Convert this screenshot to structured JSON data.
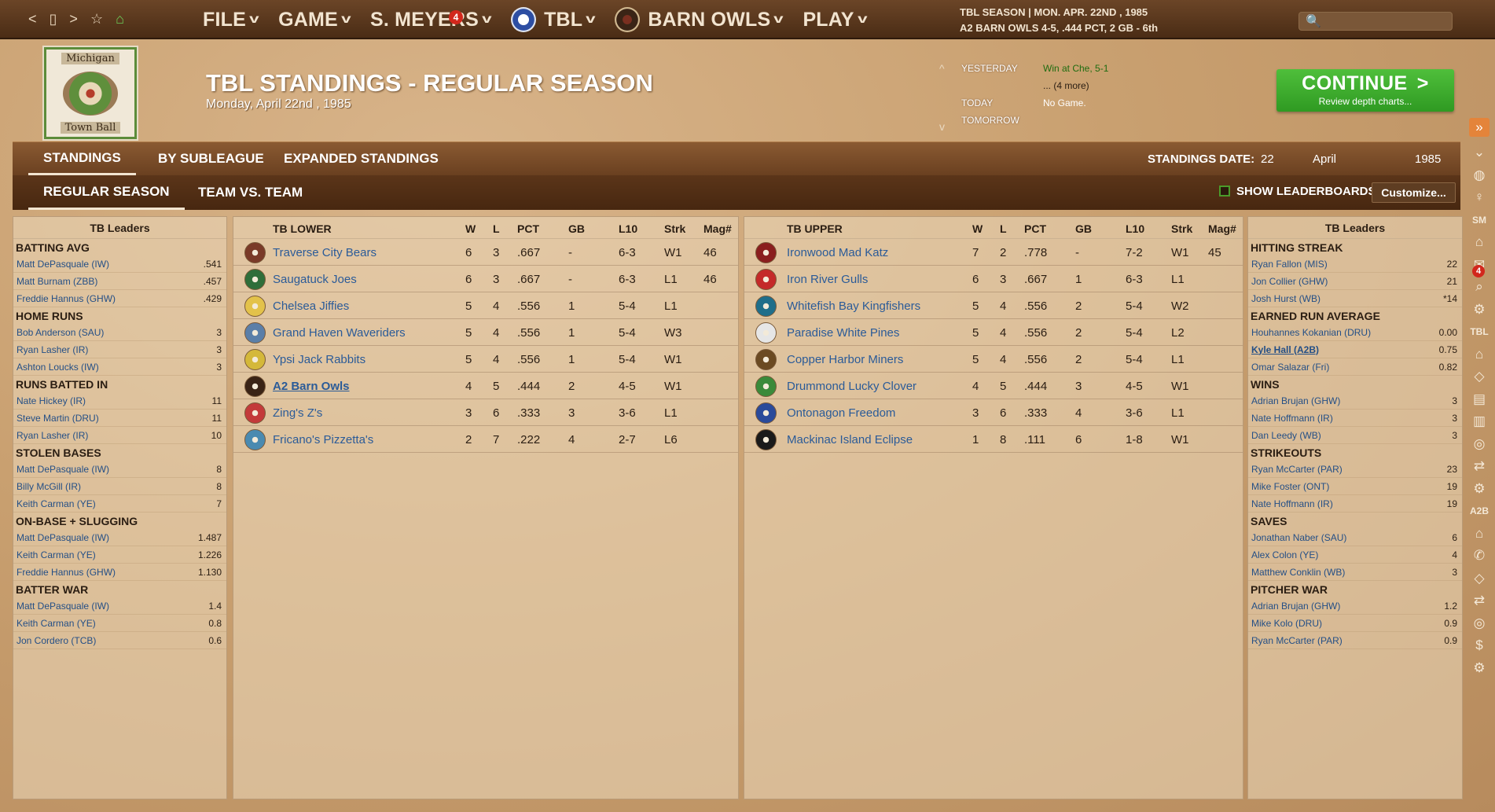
{
  "nav": {
    "back": "<",
    "page": "▯",
    "forward": ">",
    "star": "☆",
    "home": "⌂"
  },
  "menus": [
    {
      "label": "FILE"
    },
    {
      "label": "GAME"
    },
    {
      "label": "S. MEYERS",
      "badge": "4"
    },
    {
      "label": "TBL"
    },
    {
      "label": "BARN OWLS"
    },
    {
      "label": "PLAY"
    }
  ],
  "season": {
    "line1": "TBL SEASON  |  MON. APR. 22ND , 1985",
    "line2": "A2 BARN OWLS  4-5, .444 PCT, 2 GB - 6th"
  },
  "search_icon": "🔍",
  "league_logo": {
    "top": "Michigan",
    "bottom": "Town Ball"
  },
  "title": "TBL STANDINGS - REGULAR SEASON",
  "date": "Monday, April 22nd , 1985",
  "schedule": {
    "yesterday_label": "YESTERDAY",
    "yesterday_val": "Win at Che, 5-1",
    "more": "... (4 more)",
    "today_label": "TODAY",
    "today_val": "No Game.",
    "tomorrow_label": "TOMORROW"
  },
  "continue": {
    "label": "CONTINUE",
    "sub": "Review depth charts..."
  },
  "tabs": {
    "standings": "STANDINGS",
    "subleague": "BY SUBLEAGUE",
    "expanded": "EXPANDED STANDINGS",
    "regular": "REGULAR SEASON",
    "tvt": "TEAM VS. TEAM"
  },
  "standings_date": {
    "label": "STANDINGS DATE:",
    "day": "22",
    "month": "April",
    "year": "1985"
  },
  "show_leaderboards": "SHOW LEADERBOARDS",
  "customize": "Customize...",
  "left_leaders": {
    "title": "TB Leaders",
    "cats": [
      {
        "name": "BATTING AVG",
        "rows": [
          [
            "Matt DePasquale (IW)",
            ".541"
          ],
          [
            "Matt Burnam (ZBB)",
            ".457"
          ],
          [
            "Freddie Hannus (GHW)",
            ".429"
          ]
        ]
      },
      {
        "name": "HOME RUNS",
        "rows": [
          [
            "Bob Anderson (SAU)",
            "3"
          ],
          [
            "Ryan Lasher (IR)",
            "3"
          ],
          [
            "Ashton Loucks (IW)",
            "3"
          ]
        ]
      },
      {
        "name": "RUNS BATTED IN",
        "rows": [
          [
            "Nate Hickey (IR)",
            "11"
          ],
          [
            "Steve Martin (DRU)",
            "11"
          ],
          [
            "Ryan Lasher (IR)",
            "10"
          ]
        ]
      },
      {
        "name": "STOLEN BASES",
        "rows": [
          [
            "Matt DePasquale (IW)",
            "8"
          ],
          [
            "Billy McGill (IR)",
            "8"
          ],
          [
            "Keith Carman (YE)",
            "7"
          ]
        ]
      },
      {
        "name": "ON-BASE + SLUGGING",
        "rows": [
          [
            "Matt DePasquale (IW)",
            "1.487"
          ],
          [
            "Keith Carman (YE)",
            "1.226"
          ],
          [
            "Freddie Hannus (GHW)",
            "1.130"
          ]
        ]
      },
      {
        "name": "BATTER WAR",
        "rows": [
          [
            "Matt DePasquale (IW)",
            "1.4"
          ],
          [
            "Keith Carman (YE)",
            "0.8"
          ],
          [
            "Jon Cordero (TCB)",
            "0.6"
          ]
        ]
      }
    ]
  },
  "right_leaders": {
    "title": "TB Leaders",
    "cats": [
      {
        "name": "HITTING STREAK",
        "rows": [
          [
            "Ryan Fallon (MIS)",
            "22"
          ],
          [
            "Jon Collier (GHW)",
            "21"
          ],
          [
            "Josh Hurst (WB)",
            "*14"
          ]
        ]
      },
      {
        "name": "EARNED RUN AVERAGE",
        "rows": [
          [
            "Houhannes Kokanian (DRU)",
            "0.00"
          ],
          [
            "Kyle Hall (A2B)",
            "0.75"
          ],
          [
            "Omar Salazar (Fri)",
            "0.82"
          ]
        ]
      },
      {
        "name": "WINS",
        "rows": [
          [
            "Adrian Brujan (GHW)",
            "3"
          ],
          [
            "Nate Hoffmann (IR)",
            "3"
          ],
          [
            "Dan Leedy (WB)",
            "3"
          ]
        ]
      },
      {
        "name": "STRIKEOUTS",
        "rows": [
          [
            "Ryan McCarter (PAR)",
            "23"
          ],
          [
            "Mike Foster (ONT)",
            "19"
          ],
          [
            "Nate Hoffmann (IR)",
            "19"
          ]
        ]
      },
      {
        "name": "SAVES",
        "rows": [
          [
            "Jonathan Naber (SAU)",
            "6"
          ],
          [
            "Alex Colon (YE)",
            "4"
          ],
          [
            "Matthew Conklin (WB)",
            "3"
          ]
        ]
      },
      {
        "name": "PITCHER WAR",
        "rows": [
          [
            "Adrian Brujan (GHW)",
            "1.2"
          ],
          [
            "Mike Kolo (DRU)",
            "0.9"
          ],
          [
            "Ryan McCarter (PAR)",
            "0.9"
          ]
        ]
      }
    ]
  },
  "cols": {
    "w": "W",
    "l": "L",
    "pct": "PCT",
    "gb": "GB",
    "l10": "L10",
    "strk": "Strk",
    "mag": "Mag#"
  },
  "lower": {
    "title": "TB LOWER",
    "teams": [
      {
        "name": "Traverse City Bears",
        "w": "6",
        "l": "3",
        "pct": ".667",
        "gb": "-",
        "l10": "6-3",
        "strk": "W1",
        "mag": "46",
        "color": "#7a3a28"
      },
      {
        "name": "Saugatuck Joes",
        "w": "6",
        "l": "3",
        "pct": ".667",
        "gb": "-",
        "l10": "6-3",
        "strk": "L1",
        "mag": "46",
        "color": "#2f6e3a"
      },
      {
        "name": "Chelsea Jiffies",
        "w": "5",
        "l": "4",
        "pct": ".556",
        "gb": "1",
        "l10": "5-4",
        "strk": "L1",
        "mag": "",
        "color": "#e3c24a"
      },
      {
        "name": "Grand Haven Waveriders",
        "w": "5",
        "l": "4",
        "pct": ".556",
        "gb": "1",
        "l10": "5-4",
        "strk": "W3",
        "mag": "",
        "color": "#5b7fa8"
      },
      {
        "name": "Ypsi Jack Rabbits",
        "w": "5",
        "l": "4",
        "pct": ".556",
        "gb": "1",
        "l10": "5-4",
        "strk": "W1",
        "mag": "",
        "color": "#d4b83a"
      },
      {
        "name": "A2 Barn Owls",
        "w": "4",
        "l": "5",
        "pct": ".444",
        "gb": "2",
        "l10": "4-5",
        "strk": "W1",
        "mag": "",
        "color": "#3a2416"
      },
      {
        "name": "Zing's Z's",
        "w": "3",
        "l": "6",
        "pct": ".333",
        "gb": "3",
        "l10": "3-6",
        "strk": "L1",
        "mag": "",
        "color": "#c33a3a"
      },
      {
        "name": "Fricano's Pizzetta's",
        "w": "2",
        "l": "7",
        "pct": ".222",
        "gb": "4",
        "l10": "2-7",
        "strk": "L6",
        "mag": "",
        "color": "#4a8ab0"
      }
    ]
  },
  "upper": {
    "title": "TB UPPER",
    "teams": [
      {
        "name": "Ironwood Mad Katz",
        "w": "7",
        "l": "2",
        "pct": ".778",
        "gb": "-",
        "l10": "7-2",
        "strk": "W1",
        "mag": "45",
        "color": "#8a1e1e"
      },
      {
        "name": "Iron River Gulls",
        "w": "6",
        "l": "3",
        "pct": ".667",
        "gb": "1",
        "l10": "6-3",
        "strk": "L1",
        "mag": "",
        "color": "#c42a2a"
      },
      {
        "name": "Whitefish Bay Kingfishers",
        "w": "5",
        "l": "4",
        "pct": ".556",
        "gb": "2",
        "l10": "5-4",
        "strk": "W2",
        "mag": "",
        "color": "#1f6e8a"
      },
      {
        "name": "Paradise White Pines",
        "w": "5",
        "l": "4",
        "pct": ".556",
        "gb": "2",
        "l10": "5-4",
        "strk": "L2",
        "mag": "",
        "color": "#e6e6e6"
      },
      {
        "name": "Copper Harbor Miners",
        "w": "5",
        "l": "4",
        "pct": ".556",
        "gb": "2",
        "l10": "5-4",
        "strk": "L1",
        "mag": "",
        "color": "#6b4a22"
      },
      {
        "name": "Drummond Lucky Clover",
        "w": "4",
        "l": "5",
        "pct": ".444",
        "gb": "3",
        "l10": "4-5",
        "strk": "W1",
        "mag": "",
        "color": "#3a8a3a"
      },
      {
        "name": "Ontonagon Freedom",
        "w": "3",
        "l": "6",
        "pct": ".333",
        "gb": "4",
        "l10": "3-6",
        "strk": "L1",
        "mag": "",
        "color": "#2a4a9a"
      },
      {
        "name": "Mackinac Island Eclipse",
        "w": "1",
        "l": "8",
        "pct": ".111",
        "gb": "6",
        "l10": "1-8",
        "strk": "W1",
        "mag": "",
        "color": "#1a1a1a"
      }
    ]
  },
  "sidebar": {
    "sm": "SM",
    "tbl": "TBL",
    "a2b": "A2B",
    "badge": "4"
  }
}
